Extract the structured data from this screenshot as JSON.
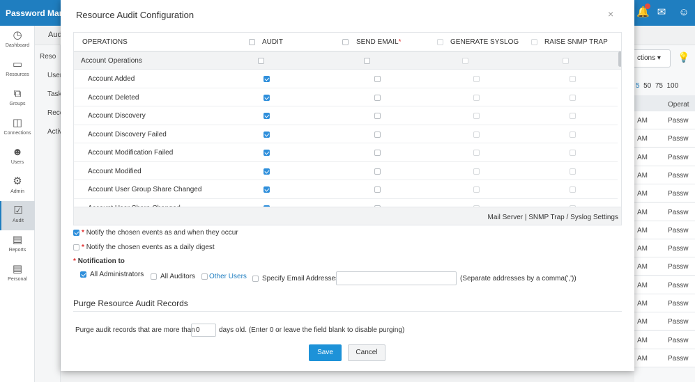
{
  "app": {
    "brand": "Password Man"
  },
  "sidebar": {
    "items": [
      {
        "label": "Dashboard",
        "icon": "dashboard-icon"
      },
      {
        "label": "Resources",
        "icon": "resources-icon"
      },
      {
        "label": "Groups",
        "icon": "groups-icon"
      },
      {
        "label": "Connections",
        "icon": "connections-icon"
      },
      {
        "label": "Users",
        "icon": "users-icon"
      },
      {
        "label": "Admin",
        "icon": "admin-icon"
      },
      {
        "label": "Audit",
        "icon": "audit-icon"
      },
      {
        "label": "Reports",
        "icon": "reports-icon"
      },
      {
        "label": "Personal",
        "icon": "personal-icon"
      }
    ]
  },
  "subnav": {
    "heading": "Aud",
    "items": [
      "Reso",
      "User",
      "Task",
      "Reco",
      "Activ"
    ]
  },
  "background": {
    "actions_label": "ctions",
    "page_sizes": [
      "5",
      "50",
      "75",
      "100"
    ],
    "column_header": "Operat",
    "rows": [
      {
        "time": "AM",
        "op": "Passw"
      },
      {
        "time": "AM",
        "op": "Passw"
      },
      {
        "time": "AM",
        "op": "Passw"
      },
      {
        "time": "AM",
        "op": "Passw"
      },
      {
        "time": "AM",
        "op": "Passw"
      },
      {
        "time": "AM",
        "op": "Passw"
      },
      {
        "time": "AM",
        "op": "Passw"
      },
      {
        "time": "AM",
        "op": "Passw"
      },
      {
        "time": "AM",
        "op": "Passw"
      },
      {
        "time": "AM",
        "op": "Passw"
      },
      {
        "time": "AM",
        "op": "Passw"
      },
      {
        "time": "AM",
        "op": "Passw"
      },
      {
        "time": "AM",
        "op": "Passw"
      },
      {
        "time": "AM",
        "op": "Passw"
      }
    ]
  },
  "modal": {
    "title": "Resource Audit Configuration",
    "close": "×",
    "columns": {
      "operations": "OPERATIONS",
      "audit": "AUDIT",
      "send_email": "SEND EMAIL",
      "send_email_required": "*",
      "syslog": "GENERATE SYSLOG",
      "snmp": "RAISE SNMP TRAP"
    },
    "group": "Account Operations",
    "operations": [
      {
        "name": "Account Added",
        "audit": true
      },
      {
        "name": "Account Deleted",
        "audit": true
      },
      {
        "name": "Account Discovery",
        "audit": true
      },
      {
        "name": "Account Discovery Failed",
        "audit": true
      },
      {
        "name": "Account Modification Failed",
        "audit": true
      },
      {
        "name": "Account Modified",
        "audit": true
      },
      {
        "name": "Account User Group Share Changed",
        "audit": true
      },
      {
        "name": "Account User Share Changed",
        "audit": true
      }
    ],
    "footer_links": "Mail Server | SNMP Trap / Syslog Settings",
    "notify_immediate": {
      "required": "*",
      "label": "Notify the chosen events as and when they occur",
      "checked": true
    },
    "notify_digest": {
      "required": "*",
      "label": "Notify the chosen events as a daily digest",
      "checked": false
    },
    "notification_to": {
      "required": "*",
      "label": "Notification to"
    },
    "recipients": {
      "all_admins": {
        "label": "All Administrators",
        "checked": true
      },
      "all_auditors": {
        "label": "All Auditors",
        "checked": false
      },
      "other_users": {
        "label": "Other Users",
        "checked": false
      },
      "specify_email": {
        "label": "Specify Email Addresses",
        "checked": false
      },
      "email_value": "",
      "email_hint": "(Separate addresses by a comma(','))"
    },
    "purge": {
      "title": "Purge Resource Audit Records",
      "prefix": "Purge audit records that are more than",
      "value": "0",
      "suffix": "days old. (Enter 0 or leave the field blank to disable purging)"
    },
    "buttons": {
      "save": "Save",
      "cancel": "Cancel"
    }
  }
}
